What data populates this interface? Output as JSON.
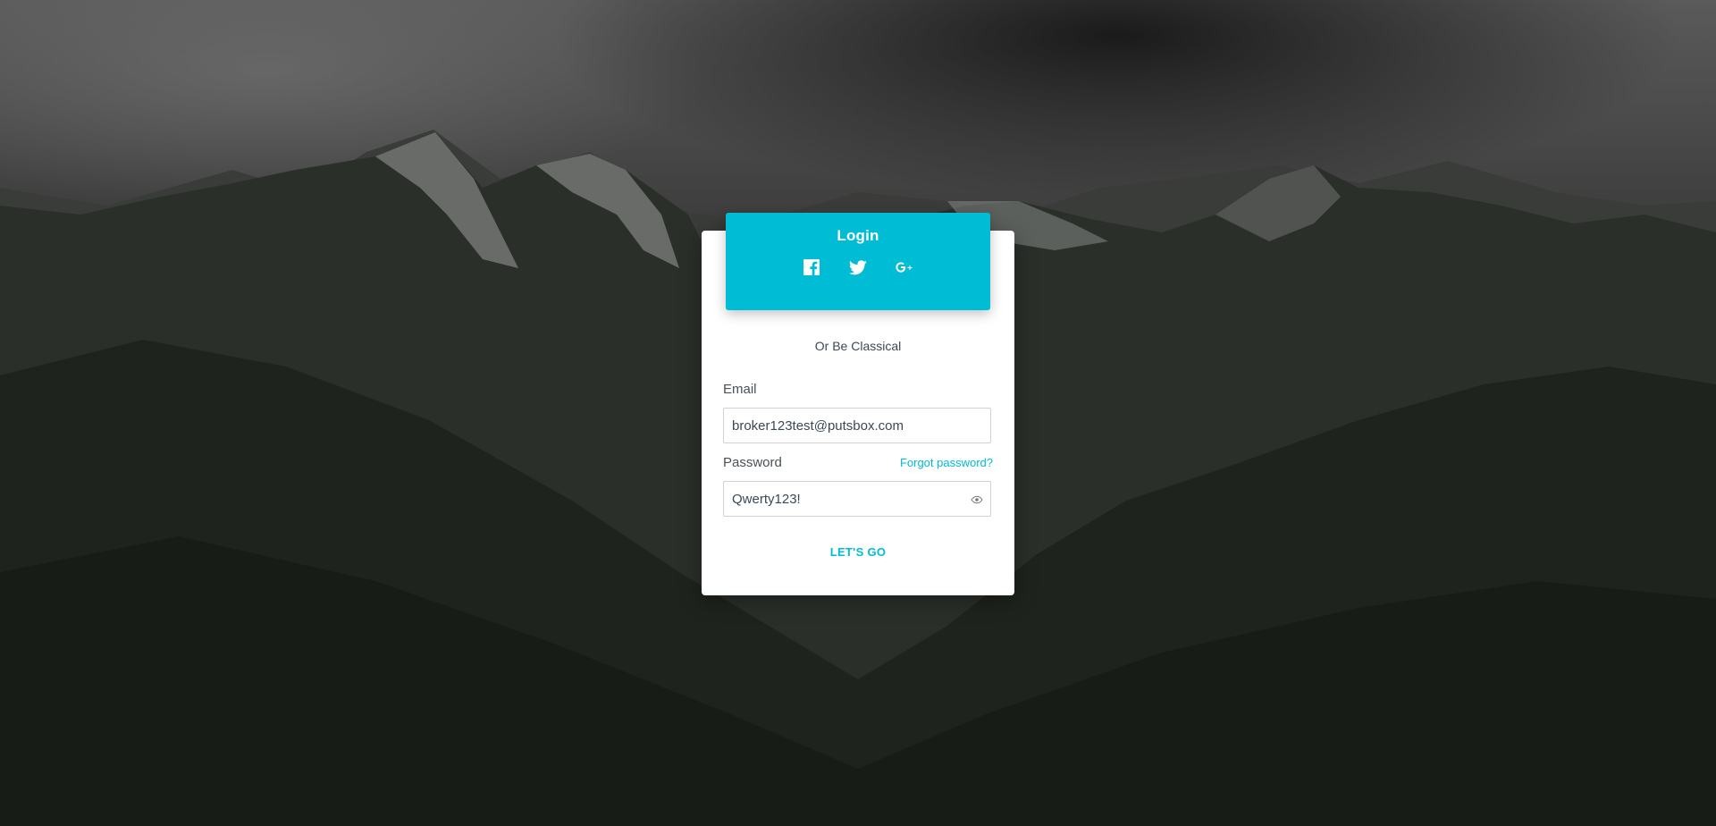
{
  "login": {
    "title": "Login",
    "social_icons": [
      "facebook-icon",
      "twitter-icon",
      "google-plus-icon"
    ],
    "divider_text": "Or Be Classical",
    "email": {
      "label": "Email",
      "value": "broker123test@putsbox.com"
    },
    "password": {
      "label": "Password",
      "value": "Qwerty123!",
      "forgot_link": "Forgot password?"
    },
    "submit_label": "LET'S GO"
  },
  "colors": {
    "accent": "#00bcd4",
    "card": "#ffffff"
  }
}
